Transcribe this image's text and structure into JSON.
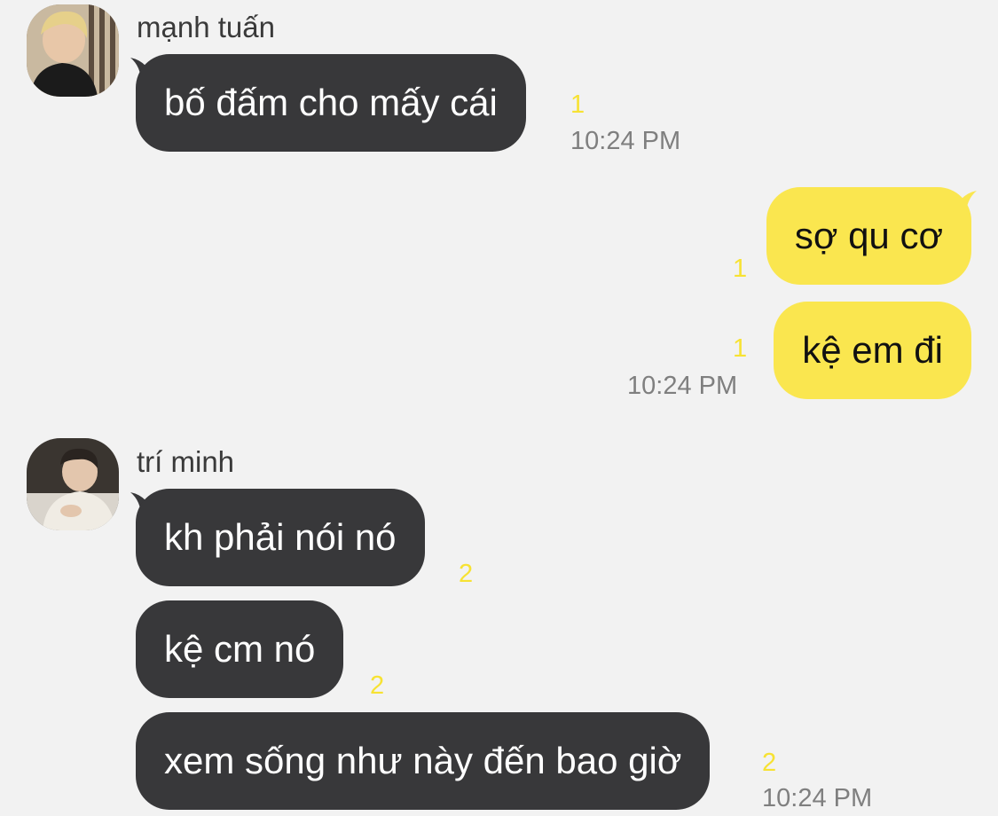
{
  "colors": {
    "background": "#f2f2f2",
    "incoming_bubble": "#38383a",
    "outgoing_bubble": "#fae64f",
    "unread_count": "#f7e233",
    "timestamp": "#7f7f7f"
  },
  "groups": [
    {
      "sender": "mạnh tuấn",
      "avatar": "profile-photo-avatar",
      "messages": [
        {
          "text": "bố đấm cho mấy cái",
          "unread": "1"
        }
      ],
      "time": "10:24 PM"
    },
    {
      "sender": "me",
      "messages": [
        {
          "text": "sợ qu cơ",
          "unread": "1"
        },
        {
          "text": "kệ em đi",
          "unread": "1"
        }
      ],
      "time": "10:24 PM"
    },
    {
      "sender": "trí minh",
      "avatar": "profile-photo-avatar",
      "messages": [
        {
          "text": "kh phải nói nó",
          "unread": "2"
        },
        {
          "text": "kệ cm nó",
          "unread": "2"
        },
        {
          "text": "xem sống như này đến bao giờ",
          "unread": "2"
        }
      ],
      "time": "10:24 PM"
    }
  ]
}
